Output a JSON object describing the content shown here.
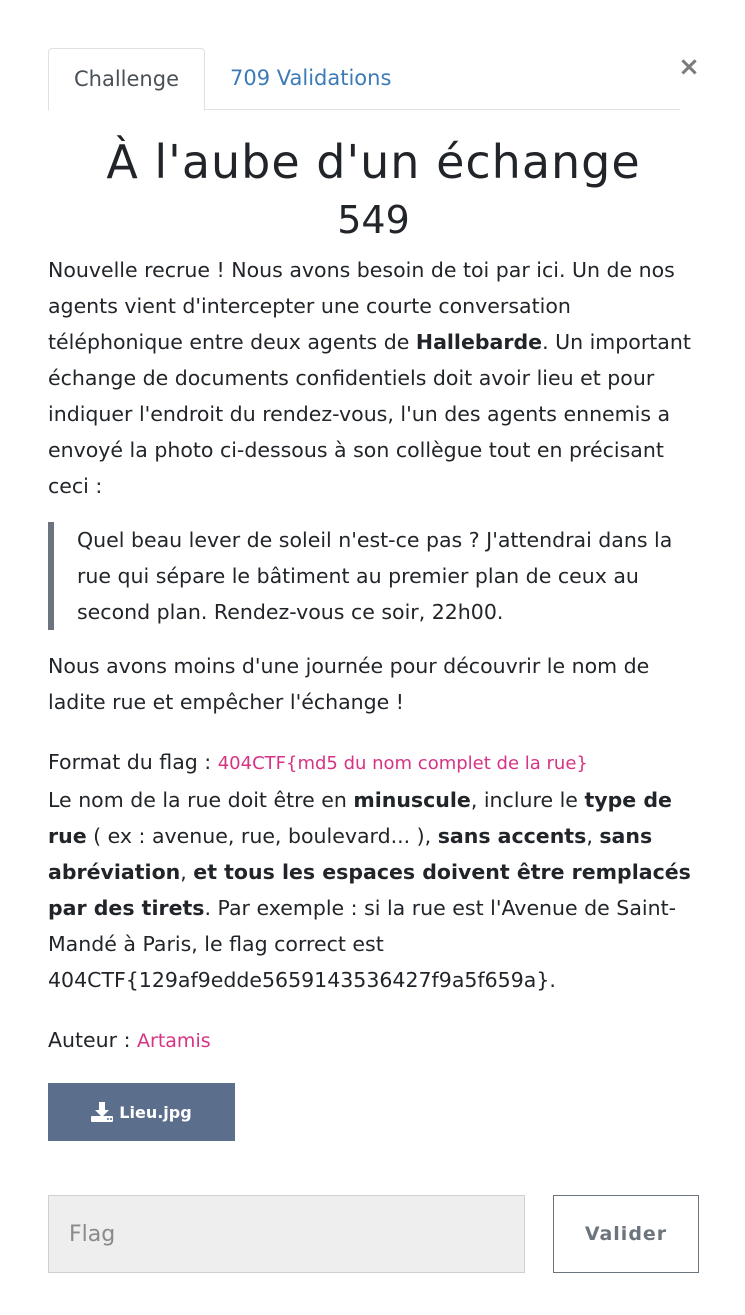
{
  "tabs": [
    {
      "label": "Challenge"
    },
    {
      "label": "709 Validations"
    }
  ],
  "close_glyph": "×",
  "challenge": {
    "title": "À l'aube d'un échange",
    "points": "549",
    "p1": [
      "Nouvelle recrue ! Nous avons besoin de toi par ici. Un de nos agents vient d'intercepter une courte conversation téléphonique entre deux agents de ",
      "Hallebarde",
      ". Un important échange de documents confidentiels doit avoir lieu et pour indiquer l'endroit du rendez-vous, l'un des agents ennemis a envoyé la photo ci-dessous à son collègue tout en précisant ceci :"
    ],
    "quote": "Quel beau lever de soleil n'est-ce pas ? J'attendrai dans la rue qui sépare le bâtiment au premier plan de ceux au second plan. Rendez-vous ce soir, 22h00.",
    "p2": "Nous avons moins d'une journée pour découvrir le nom de ladite rue et empêcher l'échange !",
    "format_label": "Format du flag : ",
    "format_code": "404CTF{md5 du nom complet de la rue}",
    "rules": [
      "Le nom de la rue doit être en ",
      "minuscule",
      ", inclure le ",
      "type de rue",
      " ( ex : avenue, rue, boulevard... ), ",
      "sans accents",
      ", ",
      "sans abréviation",
      ", ",
      "et tous les espaces doivent être remplacés par des tirets",
      ". Par exemple : si la rue est l'Avenue de Saint-Mandé à Paris, le flag correct est 404CTF{129af9edde5659143536427f9a5f659a}."
    ],
    "author_label": "Auteur : ",
    "author_name": "Artamis",
    "file_label": "Lieu.jpg",
    "file_icon": "download-icon"
  },
  "form": {
    "flag_placeholder": "Flag",
    "flag_value": "",
    "submit_label": "Valider"
  }
}
